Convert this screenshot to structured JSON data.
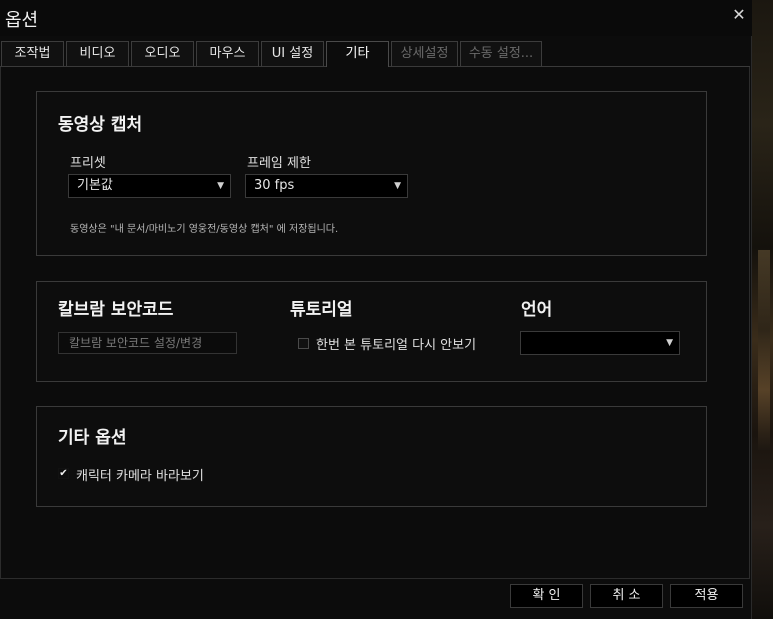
{
  "window": {
    "title": "옵션",
    "close_icon": "close-icon"
  },
  "tabs": [
    {
      "label": "조작법",
      "state": "normal"
    },
    {
      "label": "비디오",
      "state": "normal"
    },
    {
      "label": "오디오",
      "state": "normal"
    },
    {
      "label": "마우스",
      "state": "normal"
    },
    {
      "label": "UI 설정",
      "state": "normal"
    },
    {
      "label": "기타",
      "state": "active"
    },
    {
      "label": "상세설정",
      "state": "disabled"
    },
    {
      "label": "수동 설정...",
      "state": "disabled"
    }
  ],
  "video_capture": {
    "title": "동영상 캡처",
    "preset_label": "프리셋",
    "preset_value": "기본값",
    "frame_limit_label": "프레임 제한",
    "frame_limit_value": "30 fps",
    "save_note": "동영상은 \"내 문서/마비노기 영웅전/동영상 캡처\" 에 저장됩니다."
  },
  "security": {
    "title": "칼브람 보안코드",
    "button_label": "칼브람 보안코드 설정/변경"
  },
  "tutorial": {
    "title": "튜토리얼",
    "checkbox_label": "한번 본 튜토리얼 다시 안보기",
    "checked": false
  },
  "language": {
    "title": "언어",
    "value": ""
  },
  "other_options": {
    "title": "기타 옵션",
    "camera_label": "캐릭터 카메라 바라보기",
    "camera_checked": true,
    "check_mark": "✔"
  },
  "footer": {
    "confirm_label": "확 인",
    "cancel_label": "취 소",
    "apply_label": "적용"
  },
  "colors": {
    "window_bg": "#0c0c0c",
    "panel_border": "#3a3a3a",
    "text": "#e0e0e0",
    "disabled_text": "#6a6a6a"
  }
}
